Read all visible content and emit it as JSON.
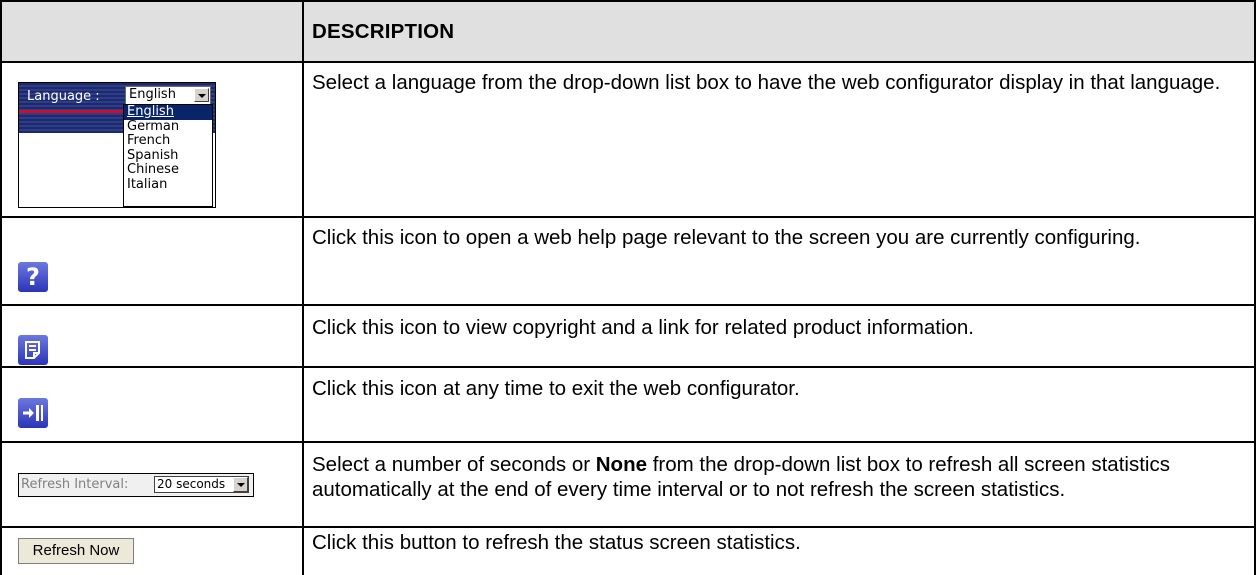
{
  "table": {
    "header_left": "",
    "header_right": "DESCRIPTION",
    "rows": [
      {
        "description": "Select a language from the drop-down list box to have the web configurator display in that language."
      },
      {
        "description": "Click this icon to open a web help page relevant to the screen you are currently configuring."
      },
      {
        "description": "Click this icon to view copyright and a link for related product information."
      },
      {
        "description": "Click this icon at any time to exit the web configurator."
      },
      {
        "description_parts": [
          "Select a number of seconds or ",
          "None",
          " from the drop-down list box to refresh all screen statistics automatically at the end of every time interval or to not refresh the screen statistics."
        ]
      },
      {
        "description": "Click this button to refresh the status screen statistics."
      }
    ]
  },
  "language_widget": {
    "label": "Language :",
    "selected": "English",
    "options": [
      "English",
      "German",
      "French",
      "Spanish",
      "Chinese",
      "Italian"
    ]
  },
  "icons": {
    "help": "help-icon",
    "info": "info-icon",
    "exit": "logout-icon"
  },
  "refresh_interval": {
    "label": "Refresh Interval:",
    "selected": "20 seconds"
  },
  "refresh_now": {
    "label": "Refresh Now"
  }
}
